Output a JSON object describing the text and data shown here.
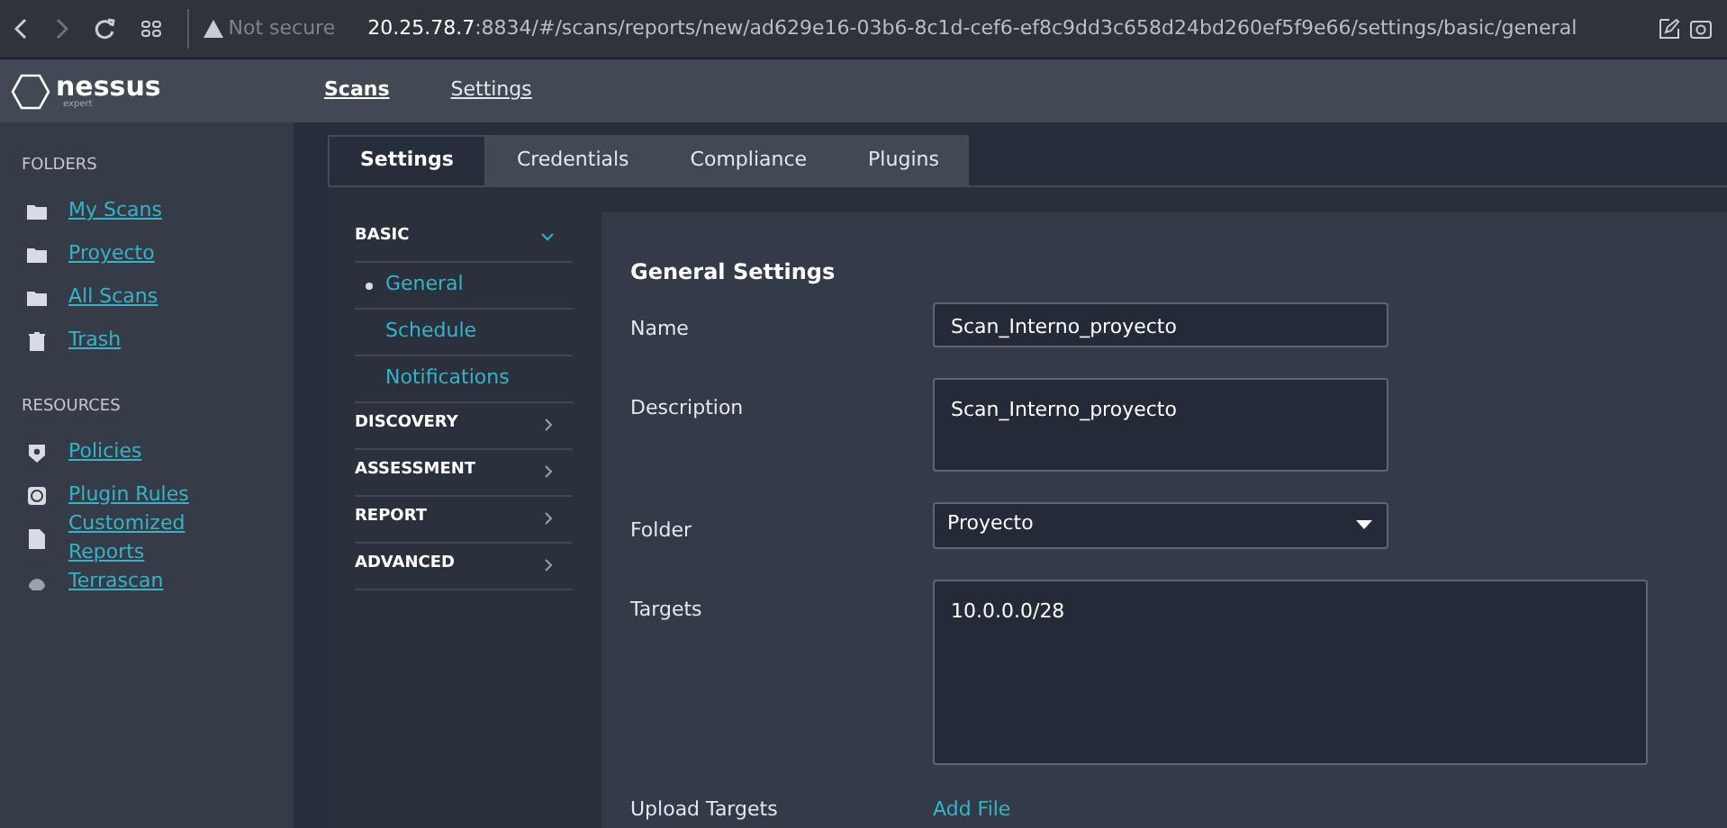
{
  "browser": {
    "security": "Not secure",
    "url_host": "20.25.78.7",
    "url_rest": ":8834/#/scans/reports/new/ad629e16-03b6-8c1d-cef6-ef8c9dd3c658d24bd260ef5f9e66/settings/basic/general"
  },
  "header": {
    "logo": "nessus",
    "logo_sub": "expert",
    "nav": [
      {
        "label": "Scans",
        "selected": true
      },
      {
        "label": "Settings",
        "selected": false
      }
    ]
  },
  "sidebar": [
    {
      "heading": "FOLDERS",
      "items": [
        {
          "label": "My Scans"
        },
        {
          "label": "Proyecto"
        },
        {
          "label": "All Scans"
        },
        {
          "label": "Trash"
        }
      ]
    },
    {
      "heading": "RESOURCES",
      "items": [
        {
          "label": "Policies"
        },
        {
          "label": "Plugin Rules"
        },
        {
          "label": "Customized Reports"
        },
        {
          "label": "Terrascan"
        }
      ]
    }
  ],
  "tabs": [
    {
      "label": "Settings",
      "selected": true
    },
    {
      "label": "Credentials",
      "selected": false
    },
    {
      "label": "Compliance",
      "selected": false
    },
    {
      "label": "Plugins",
      "selected": false
    }
  ],
  "settings_nav": [
    {
      "label": "BASIC",
      "expanded": true,
      "children": [
        {
          "label": "General",
          "selected": true
        },
        {
          "label": "Schedule",
          "selected": false
        },
        {
          "label": "Notifications",
          "selected": false
        }
      ]
    },
    {
      "label": "DISCOVERY",
      "expanded": false
    },
    {
      "label": "ASSESSMENT",
      "expanded": false
    },
    {
      "label": "REPORT",
      "expanded": false
    },
    {
      "label": "ADVANCED",
      "expanded": false
    }
  ],
  "form": {
    "title": "General Settings",
    "fields": [
      {
        "label": "Name",
        "kind": "text",
        "value": "Scan_Interno_proyecto"
      },
      {
        "label": "Description",
        "kind": "textarea",
        "value": "Scan_Interno_proyecto"
      },
      {
        "label": "Folder",
        "kind": "select",
        "value": "Proyecto"
      },
      {
        "label": "Targets",
        "kind": "bigarea",
        "value": "10.0.0.0/28"
      },
      {
        "label": "Upload Targets",
        "kind": "link",
        "value": "Add File"
      }
    ]
  }
}
